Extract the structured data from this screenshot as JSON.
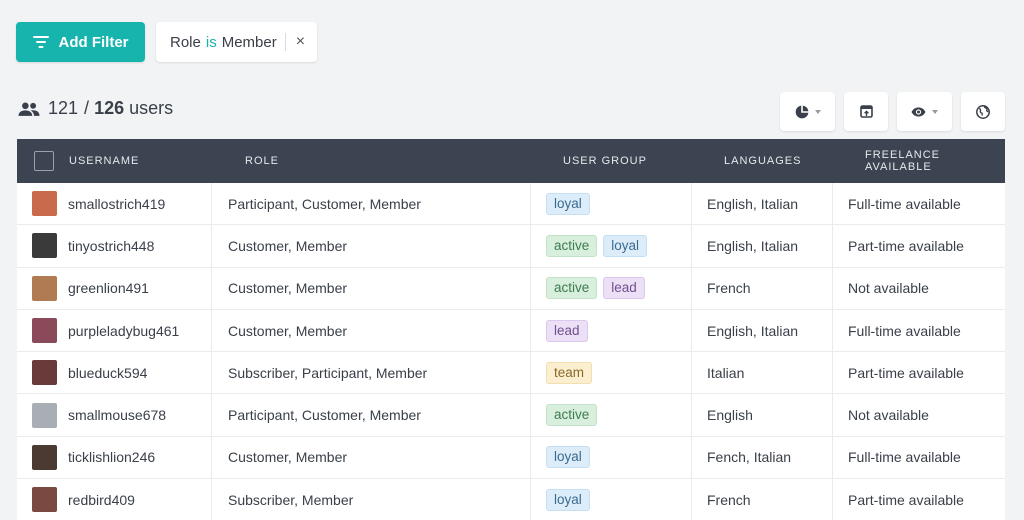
{
  "filter_bar": {
    "add_filter_label": "Add Filter",
    "chip": {
      "field": "Role",
      "operator": "is",
      "value": "Member",
      "close_glyph": "×"
    }
  },
  "summary": {
    "shown": "121",
    "separator": "/",
    "total": "126",
    "unit": "users"
  },
  "toolbar": {
    "buttons": [
      {
        "icon": "pie-chart-icon",
        "has_dropdown": true
      },
      {
        "icon": "export-icon",
        "has_dropdown": false
      },
      {
        "icon": "eye-icon",
        "has_dropdown": true
      },
      {
        "icon": "globe-icon",
        "has_dropdown": false
      }
    ]
  },
  "table": {
    "headers": [
      "USERNAME",
      "ROLE",
      "USER GROUP",
      "LANGUAGES",
      "FREELANCE AVAILABLE"
    ],
    "rows": [
      {
        "username": "smallostrich419",
        "role": "Participant, Customer, Member",
        "groups": [
          "loyal"
        ],
        "languages": "English, Italian",
        "freelance": "Full-time available",
        "avatar_color": "#c96a4a"
      },
      {
        "username": "tinyostrich448",
        "role": "Customer, Member",
        "groups": [
          "active",
          "loyal"
        ],
        "languages": "English, Italian",
        "freelance": "Part-time available",
        "avatar_color": "#3b3a3a"
      },
      {
        "username": "greenlion491",
        "role": "Customer, Member",
        "groups": [
          "active",
          "lead"
        ],
        "languages": "French",
        "freelance": "Not available",
        "avatar_color": "#b07a52"
      },
      {
        "username": "purpleladybug461",
        "role": "Customer, Member",
        "groups": [
          "lead"
        ],
        "languages": "English, Italian",
        "freelance": "Full-time available",
        "avatar_color": "#8a4a5a"
      },
      {
        "username": "blueduck594",
        "role": "Subscriber, Participant, Member",
        "groups": [
          "team"
        ],
        "languages": "Italian",
        "freelance": "Part-time available",
        "avatar_color": "#6a3a3a"
      },
      {
        "username": "smallmouse678",
        "role": "Participant, Customer, Member",
        "groups": [
          "active"
        ],
        "languages": "English",
        "freelance": "Not available",
        "avatar_color": "#a9aeb4"
      },
      {
        "username": "ticklishlion246",
        "role": "Customer, Member",
        "groups": [
          "loyal"
        ],
        "languages": "Fench, Italian",
        "freelance": "Full-time available",
        "avatar_color": "#4a3a32"
      },
      {
        "username": "redbird409",
        "role": "Subscriber, Member",
        "groups": [
          "loyal"
        ],
        "languages": "French",
        "freelance": "Part-time available",
        "avatar_color": "#7a4a42"
      }
    ]
  },
  "colors": {
    "accent": "#17b3ad",
    "header_bg": "#3b4450",
    "page_bg": "#f2f3f5"
  }
}
